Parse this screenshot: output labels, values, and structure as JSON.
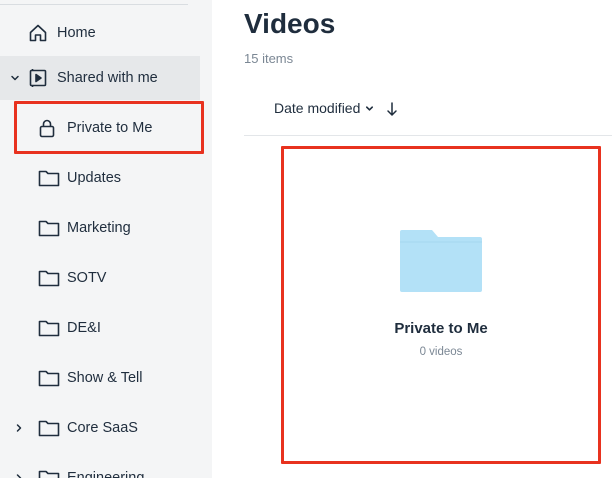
{
  "sidebar": {
    "items": [
      {
        "label": "Home",
        "icon": "home-icon"
      },
      {
        "label": "Shared with me",
        "icon": "shared-video-icon",
        "expanded": true
      },
      {
        "label": "Private to Me",
        "icon": "lock-icon",
        "selected": true
      },
      {
        "label": "Updates",
        "icon": "folder-icon"
      },
      {
        "label": "Marketing",
        "icon": "folder-icon"
      },
      {
        "label": "SOTV",
        "icon": "folder-icon"
      },
      {
        "label": "DE&I",
        "icon": "folder-icon"
      },
      {
        "label": "Show & Tell",
        "icon": "folder-icon"
      },
      {
        "label": "Core SaaS",
        "icon": "folder-icon",
        "expandable": true
      },
      {
        "label": "Engineering",
        "icon": "folder-icon",
        "expandable": true
      }
    ]
  },
  "main": {
    "title": "Videos",
    "count": "15 items",
    "sort_label": "Date modified",
    "sort_direction": "descending"
  },
  "card": {
    "title": "Private to Me",
    "subtitle": "0 videos",
    "folder_color": "#b3e1f7"
  },
  "colors": {
    "highlight": "#e8321f",
    "sidebar_bg": "#f4f5f6",
    "text": "#1f2d3d",
    "muted": "#7b8794"
  }
}
